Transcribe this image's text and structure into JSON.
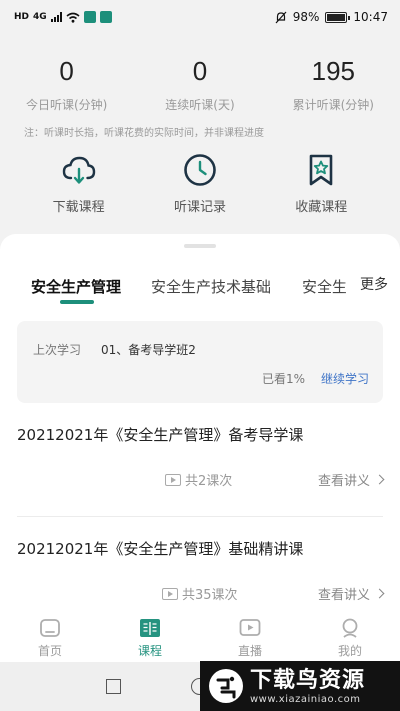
{
  "status_bar": {
    "left_badge": "HD",
    "network": "4G",
    "battery": "98%",
    "battery_level": 0.98,
    "time": "10:47"
  },
  "stats": [
    {
      "value": "0",
      "label": "今日听课(分钟)"
    },
    {
      "value": "0",
      "label": "连续听课(天)"
    },
    {
      "value": "195",
      "label": "累计听课(分钟)"
    }
  ],
  "note": "注：听课时长指，听课花费的实际时间，并非课程进度",
  "actions": [
    {
      "label": "下载课程",
      "icon": "cloud-download-icon"
    },
    {
      "label": "听课记录",
      "icon": "clock-icon"
    },
    {
      "label": "收藏课程",
      "icon": "bookmark-star-icon"
    }
  ],
  "tabs": {
    "items": [
      "安全生产管理",
      "安全生产技术基础",
      "安全生"
    ],
    "active_index": 0,
    "more": "更多"
  },
  "last_study": {
    "label": "上次学习",
    "title": "01、备考导学班2",
    "progress": "已看1%",
    "progress_value": 0.01,
    "continue": "继续学习"
  },
  "courses": [
    {
      "title": "20212021年《安全生产管理》备考导学课",
      "lessons": "共2课次",
      "notes": "查看讲义"
    },
    {
      "title": "20212021年《安全生产管理》基础精讲课",
      "lessons": "共35课次",
      "notes": "查看讲义"
    }
  ],
  "bottom_nav": [
    {
      "label": "首页",
      "icon": "home-icon"
    },
    {
      "label": "课程",
      "icon": "course-book-icon",
      "active": true
    },
    {
      "label": "直播",
      "icon": "live-play-icon"
    },
    {
      "label": "我的",
      "icon": "profile-icon"
    }
  ],
  "watermark": {
    "main": "下载鸟资源",
    "sub": "www.xiazainiao.com"
  },
  "colors": {
    "accent": "#1d8f7b",
    "link": "#3f74c7",
    "icon_dark": "#1e3344"
  }
}
